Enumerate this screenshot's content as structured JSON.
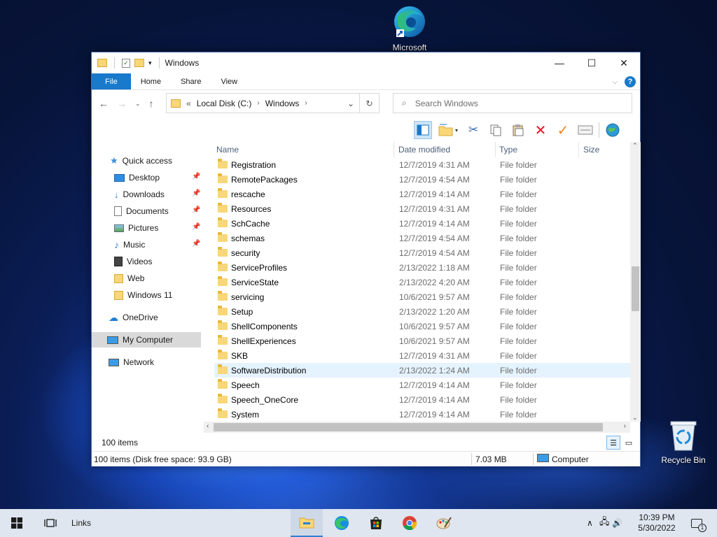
{
  "desktop": {
    "icons": [
      {
        "label": "Microsoft"
      },
      {
        "label": "Recycle Bin"
      }
    ]
  },
  "window": {
    "title": "Windows",
    "controls": {
      "minimize": "—",
      "maximize": "☐",
      "close": "✕"
    },
    "ribbon_tabs": [
      "File",
      "Home",
      "Share",
      "View"
    ],
    "help": "?",
    "address": {
      "prefix": "«",
      "crumbs": [
        "Local Disk (C:)",
        "Windows"
      ]
    },
    "search_placeholder": "Search Windows",
    "columns": [
      "Name",
      "Date modified",
      "Type",
      "Size"
    ],
    "sidebar": [
      {
        "label": "Quick access",
        "pinned": false
      },
      {
        "label": "Desktop",
        "pinned": true
      },
      {
        "label": "Downloads",
        "pinned": true
      },
      {
        "label": "Documents",
        "pinned": true
      },
      {
        "label": "Pictures",
        "pinned": true
      },
      {
        "label": "Music",
        "pinned": true
      },
      {
        "label": "Videos",
        "pinned": false
      },
      {
        "label": "Web",
        "pinned": false
      },
      {
        "label": "Windows 11",
        "pinned": false
      },
      {
        "label": "OneDrive",
        "pinned": false
      },
      {
        "label": "My Computer",
        "pinned": false,
        "selected": true
      },
      {
        "label": "Network",
        "pinned": false
      }
    ],
    "files": [
      {
        "name": "Registration",
        "date": "12/7/2019 4:31 AM",
        "type": "File folder"
      },
      {
        "name": "RemotePackages",
        "date": "12/7/2019 4:54 AM",
        "type": "File folder"
      },
      {
        "name": "rescache",
        "date": "12/7/2019 4:14 AM",
        "type": "File folder"
      },
      {
        "name": "Resources",
        "date": "12/7/2019 4:31 AM",
        "type": "File folder"
      },
      {
        "name": "SchCache",
        "date": "12/7/2019 4:14 AM",
        "type": "File folder"
      },
      {
        "name": "schemas",
        "date": "12/7/2019 4:54 AM",
        "type": "File folder"
      },
      {
        "name": "security",
        "date": "12/7/2019 4:54 AM",
        "type": "File folder"
      },
      {
        "name": "ServiceProfiles",
        "date": "2/13/2022 1:18 AM",
        "type": "File folder"
      },
      {
        "name": "ServiceState",
        "date": "2/13/2022 4:20 AM",
        "type": "File folder"
      },
      {
        "name": "servicing",
        "date": "10/6/2021 9:57 AM",
        "type": "File folder"
      },
      {
        "name": "Setup",
        "date": "2/13/2022 1:20 AM",
        "type": "File folder"
      },
      {
        "name": "ShellComponents",
        "date": "10/6/2021 9:57 AM",
        "type": "File folder"
      },
      {
        "name": "ShellExperiences",
        "date": "10/6/2021 9:57 AM",
        "type": "File folder"
      },
      {
        "name": "SKB",
        "date": "12/7/2019 4:31 AM",
        "type": "File folder"
      },
      {
        "name": "SoftwareDistribution",
        "date": "2/13/2022 1:24 AM",
        "type": "File folder",
        "hover": true
      },
      {
        "name": "Speech",
        "date": "12/7/2019 4:14 AM",
        "type": "File folder"
      },
      {
        "name": "Speech_OneCore",
        "date": "12/7/2019 4:14 AM",
        "type": "File folder"
      },
      {
        "name": "System",
        "date": "12/7/2019 4:14 AM",
        "type": "File folder"
      }
    ],
    "item_count": "100 items",
    "status": {
      "left": "100 items (Disk free space: 93.9 GB)",
      "size": "7.03 MB",
      "location": "Computer"
    }
  },
  "taskbar": {
    "links_label": "Links",
    "time": "10:39 PM",
    "date": "5/30/2022",
    "notification_count": "1"
  },
  "colors": {
    "accent": "#1979ca",
    "folder": "#f8d775",
    "delete": "#e81123",
    "check": "#f0861d"
  }
}
